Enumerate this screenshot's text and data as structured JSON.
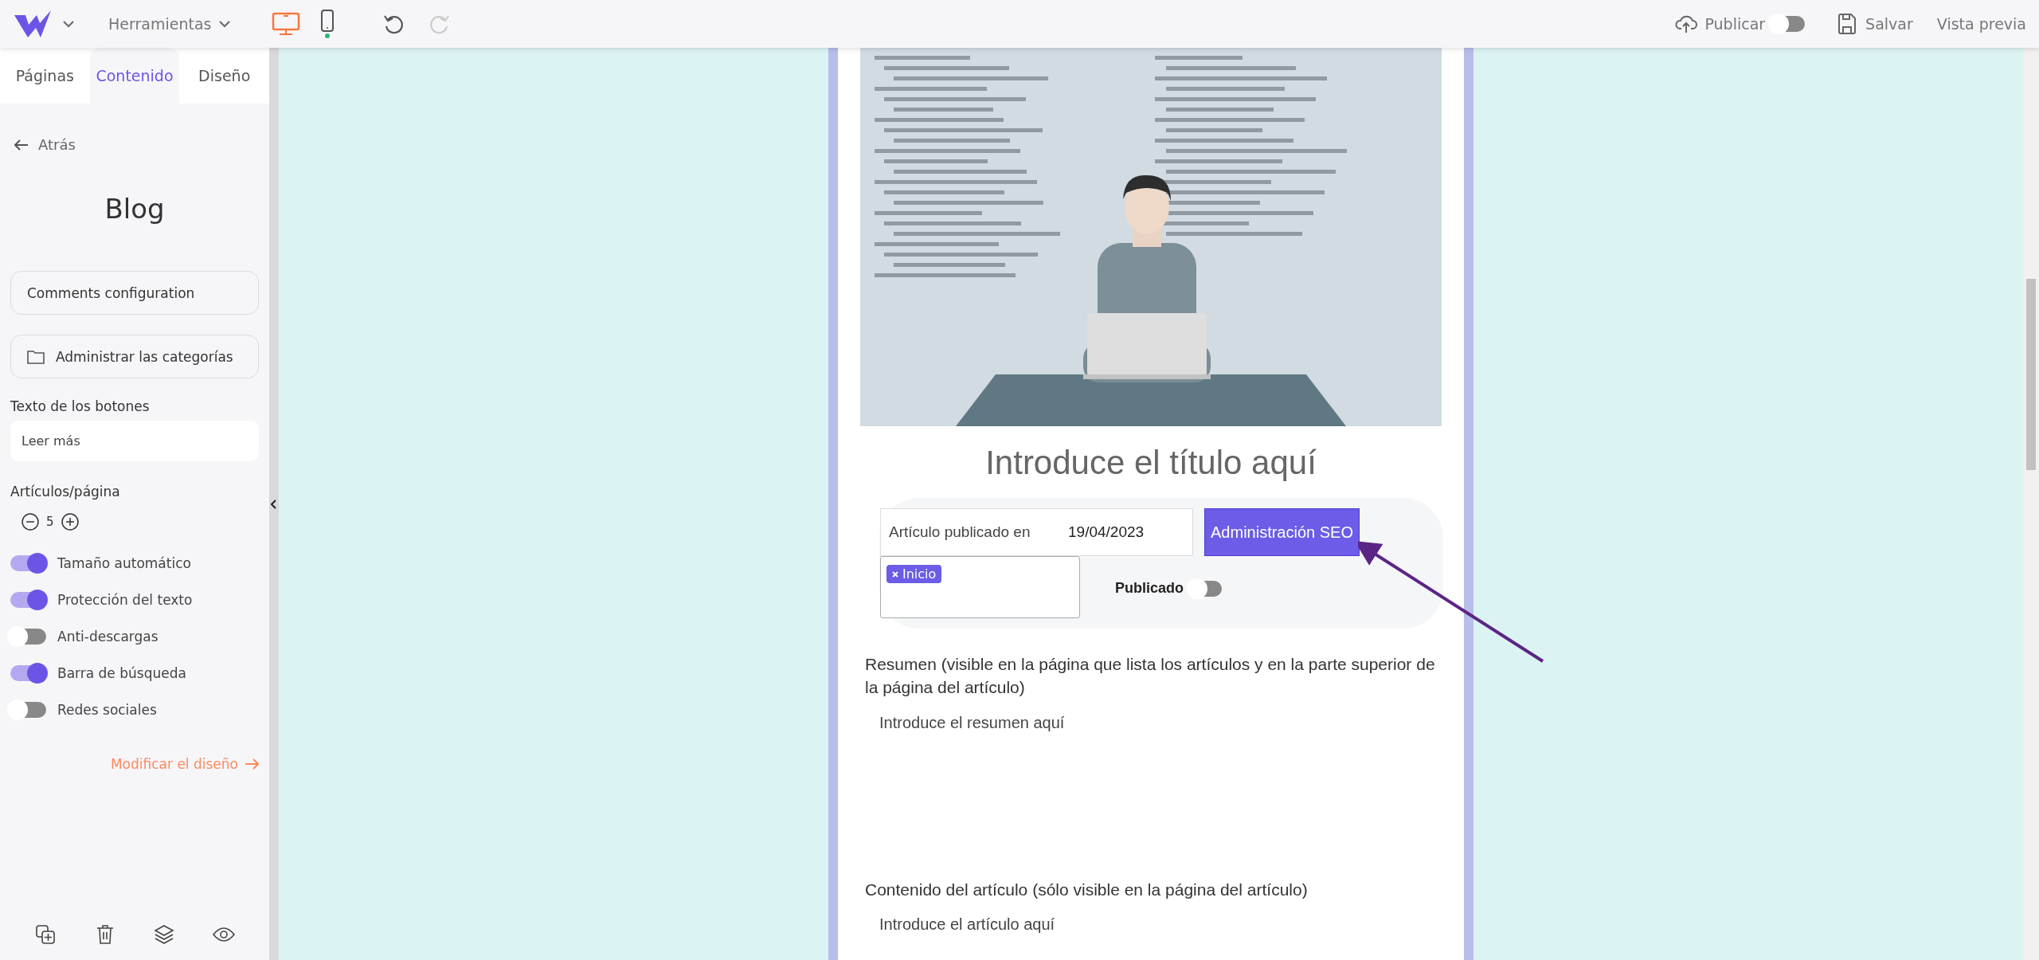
{
  "topbar": {
    "tools_menu": "Herramientas",
    "devices": [
      {
        "kind": "desktop",
        "selected": true
      },
      {
        "kind": "mobile",
        "selected": false
      }
    ],
    "undo": {
      "disabled": false
    },
    "redo": {
      "disabled": true
    },
    "publish": {
      "label": "Publicar",
      "on": false
    },
    "save": "Salvar",
    "preview": "Vista previa"
  },
  "sidebar": {
    "tabs": [
      {
        "label": "Páginas",
        "selected": false
      },
      {
        "label": "Contenido",
        "selected": true
      },
      {
        "label": "Diseño",
        "selected": false
      }
    ],
    "back": "Atrás",
    "title": "Blog",
    "buttons": [
      {
        "label": "Comments configuration",
        "kind": "plain"
      },
      {
        "label": "Administrar las categorías",
        "kind": "folder"
      }
    ],
    "button_text": {
      "label": "Texto de los botones",
      "value": "Leer más"
    },
    "per_page": {
      "label": "Artículos/página",
      "value": "5"
    },
    "toggles": [
      {
        "label": "Tamaño automático",
        "on": true
      },
      {
        "label": "Protección del texto",
        "on": true
      },
      {
        "label": "Anti-descargas",
        "on": false
      },
      {
        "label": "Barra de búsqueda",
        "on": true
      },
      {
        "label": "Redes sociales",
        "on": false
      }
    ],
    "design_link": "Modificar el diseño"
  },
  "article": {
    "title": "Introduce el título aquí",
    "date_label": "Artículo publicado en",
    "date": "19/04/2023",
    "seo_button": "Administración SEO",
    "tags": [
      {
        "label": "Inicio"
      }
    ],
    "published": {
      "label": "Publicado",
      "on": false
    },
    "summary_label": "Resumen (visible en la página que lista los artículos y en la parte superior de la página del artículo)",
    "summary_placeholder": "Introduce el resumen aquí",
    "content_label": "Contenido del artículo (sólo visible en la página del artículo)",
    "content_placeholder": "Introduce el artículo aquí"
  }
}
